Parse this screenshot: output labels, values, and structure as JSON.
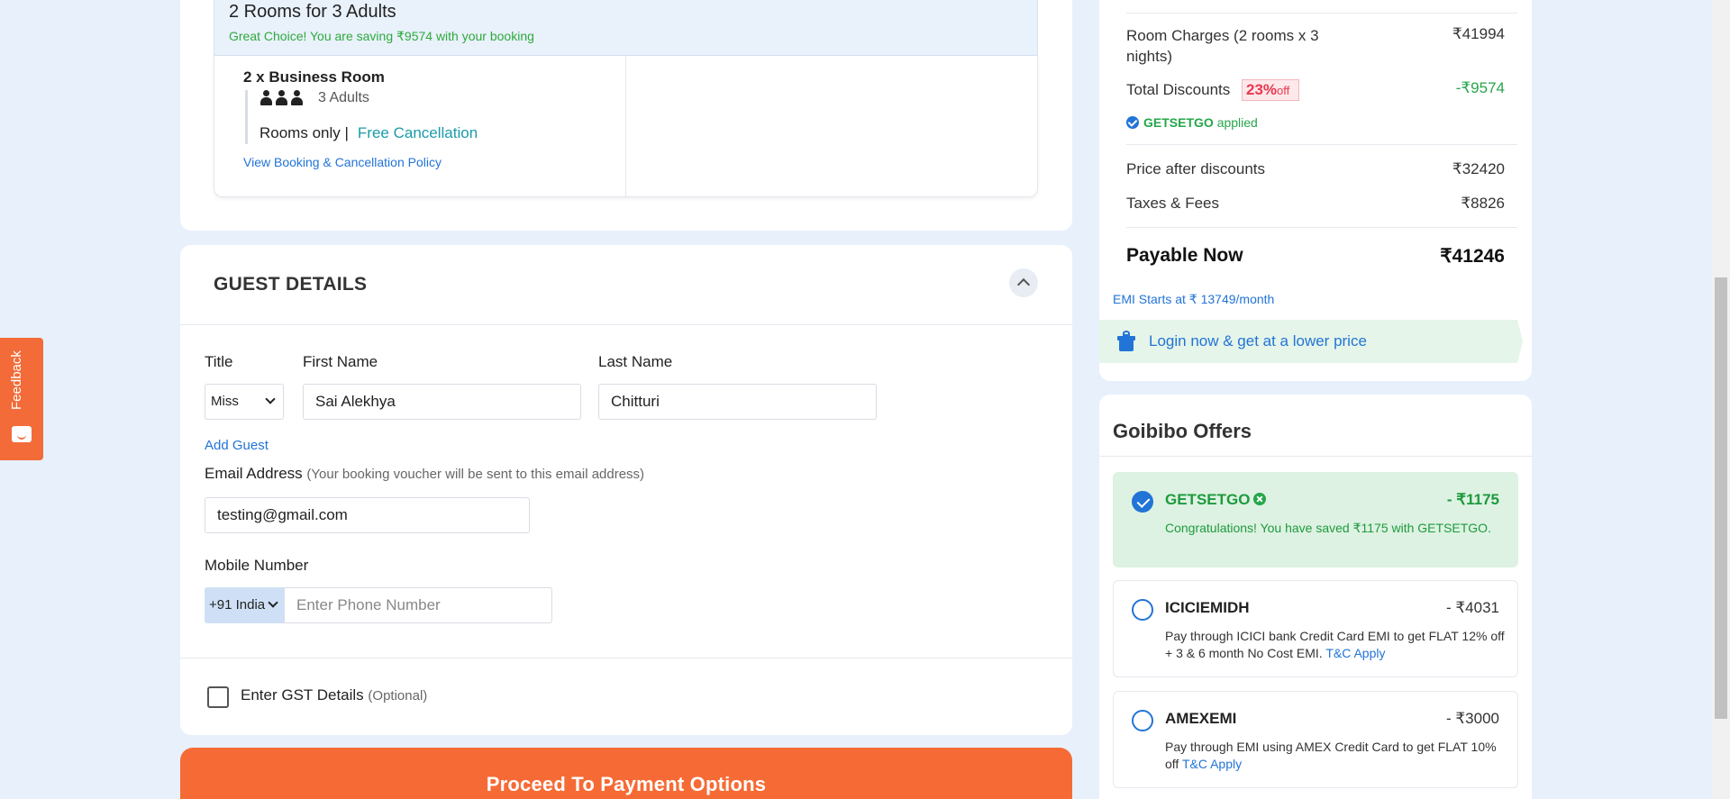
{
  "feedback": {
    "label": "Feedback"
  },
  "room": {
    "heading": "2 Rooms for 3 Adults",
    "saving": "Great Choice! You are saving ₹9574 with your booking",
    "room_name": "2 x Business Room",
    "adults": "3 Adults",
    "plan": "Rooms only |",
    "cancellation": "Free Cancellation",
    "policy_link": "View Booking & Cancellation Policy"
  },
  "guest": {
    "title": "GUEST DETAILS",
    "title_label": "Title",
    "title_value": "Miss",
    "first_name_label": "First Name",
    "first_name_value": "Sai Alekhya",
    "last_name_label": "Last Name",
    "last_name_value": "Chitturi",
    "add_guest": "Add Guest",
    "email_label": "Email Address",
    "email_hint": "(Your booking voucher will be sent to this email address)",
    "email_value": "testing@gmail.com",
    "mobile_label": "Mobile Number",
    "country_code": "+91 India",
    "phone_placeholder": "Enter Phone Number",
    "gst_label": "Enter GST Details",
    "gst_optional": "(Optional)"
  },
  "proceed": {
    "label": "Proceed To Payment Options"
  },
  "price": {
    "room_charges_label": "Room Charges (2 rooms x 3 nights)",
    "room_charges_value": "₹41994",
    "total_discounts_label": "Total Discounts",
    "discount_pct": "23%",
    "discount_off": "off",
    "total_discounts_value": "-₹9574",
    "coupon_code": "GETSETGO",
    "coupon_applied": "applied",
    "after_discount_label": "Price after discounts",
    "after_discount_value": "₹32420",
    "taxes_label": "Taxes & Fees",
    "taxes_value": "₹8826",
    "payable_label": "Payable Now",
    "payable_value": "₹41246",
    "emi": "EMI Starts at ₹ 13749/month",
    "login_banner": "Login now & get at a lower price"
  },
  "offers": {
    "title": "Goibibo Offers",
    "items": [
      {
        "code": "GETSETGO",
        "amount": "- ₹1175",
        "desc": "Congratulations! You have saved ₹1175 with GETSETGO.",
        "tnc": ""
      },
      {
        "code": "ICICIEMIDH",
        "amount": "- ₹4031",
        "desc": "Pay through ICICI bank Credit Card EMI to get FLAT 12% off + 3 & 6 month No Cost EMI.",
        "tnc": "T&C Apply"
      },
      {
        "code": "AMEXEMI",
        "amount": "- ₹3000",
        "desc": "Pay through EMI using AMEX Credit Card to get FLAT 10% off",
        "tnc": "T&C Apply"
      }
    ]
  },
  "colors": {
    "accent": "#f66b35",
    "link": "#2274d6",
    "success": "#26a64a",
    "page_bg": "#e8f0fc"
  }
}
